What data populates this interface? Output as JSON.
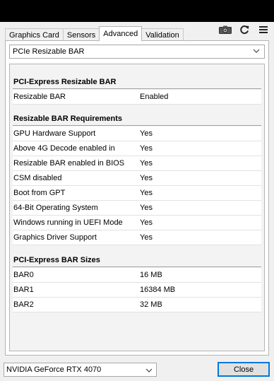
{
  "tabs": [
    "Graphics Card",
    "Sensors",
    "Advanced",
    "Validation"
  ],
  "section_select": "PCIe Resizable BAR",
  "sections": {
    "bar": {
      "title": "PCI-Express Resizable BAR",
      "rows": [
        {
          "k": "Resizable BAR",
          "v": "Enabled"
        }
      ]
    },
    "req": {
      "title": "Resizable BAR Requirements",
      "rows": [
        {
          "k": "GPU Hardware Support",
          "v": "Yes"
        },
        {
          "k": "Above 4G Decode enabled in",
          "v": "Yes"
        },
        {
          "k": "Resizable BAR enabled in BIOS",
          "v": "Yes"
        },
        {
          "k": "CSM disabled",
          "v": "Yes"
        },
        {
          "k": "Boot from GPT",
          "v": "Yes"
        },
        {
          "k": "64-Bit Operating System",
          "v": "Yes"
        },
        {
          "k": "Windows running in UEFI Mode",
          "v": "Yes"
        },
        {
          "k": "Graphics Driver Support",
          "v": "Yes"
        }
      ]
    },
    "sizes": {
      "title": "PCI-Express BAR Sizes",
      "rows": [
        {
          "k": "BAR0",
          "v": "16 MB"
        },
        {
          "k": "BAR1",
          "v": "16384 MB"
        },
        {
          "k": "BAR2",
          "v": "32 MB"
        }
      ]
    }
  },
  "gpu_select": "NVIDIA GeForce RTX 4070",
  "close_label": "Close",
  "icons": [
    "camera-icon",
    "refresh-icon",
    "menu-icon"
  ]
}
